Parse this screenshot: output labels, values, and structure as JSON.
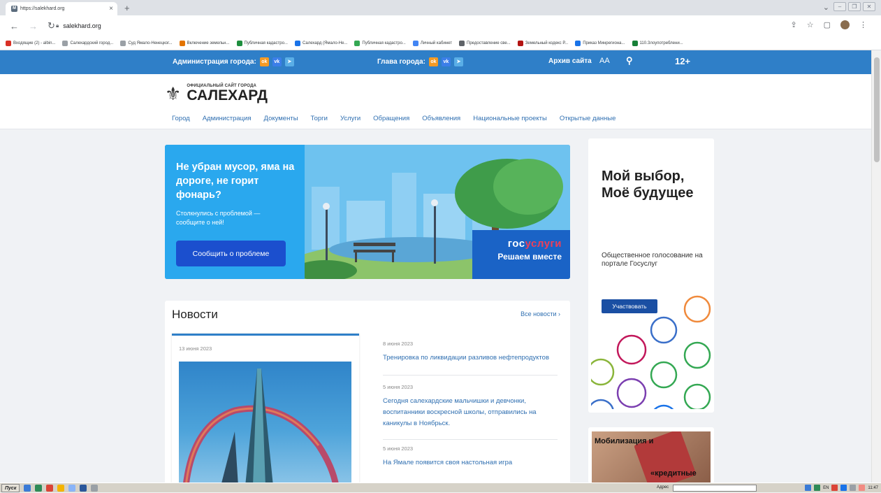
{
  "browser": {
    "tab_title": "https://salekhard.org",
    "tab_close": "×",
    "new_tab": "+",
    "url": "salekhard.org",
    "bookmarks": [
      {
        "label": "Входящие (2) - albin...",
        "color": "#d93025"
      },
      {
        "label": "Салехардский город...",
        "color": "#9aa0a6"
      },
      {
        "label": "Суд Ямало-Ненецког...",
        "color": "#9aa0a6"
      },
      {
        "label": "Включение земельн...",
        "color": "#e37400"
      },
      {
        "label": "Публичная кадастро...",
        "color": "#1e8e3e"
      },
      {
        "label": "Салехард (Ямало-Не...",
        "color": "#1a73e8"
      },
      {
        "label": "Публичная кадастро...",
        "color": "#34a853"
      },
      {
        "label": "Личный кабинет",
        "color": "#4285f4"
      },
      {
        "label": "Предоставление све...",
        "color": "#5f6368"
      },
      {
        "label": "Земельный кодекс Р...",
        "color": "#b31412"
      },
      {
        "label": "Приказ Минрегиона...",
        "color": "#1a73e8"
      },
      {
        "label": "110.Злоупотреблени...",
        "color": "#188038"
      }
    ]
  },
  "site": {
    "topbar": {
      "admin_label": "Администрация города:",
      "head_label": "Глава города:",
      "archive": "Архив сайта",
      "font_size": "AA",
      "age": "12+"
    },
    "logo": {
      "small": "ОФИЦИАЛЬНЫЙ САЙТ ГОРОДА",
      "big": "САЛЕХАРД"
    },
    "menu": [
      "Город",
      "Администрация",
      "Документы",
      "Торги",
      "Услуги",
      "Обращения",
      "Объявления",
      "Национальные проекты",
      "Открытые данные"
    ],
    "banner": {
      "heading": "Не убран мусор, яма на дороге, не горит фонарь?",
      "text": "Столкнулись с проблемой — сообщите о ней!",
      "button": "Сообщить о проблеме",
      "gos_a": "гос",
      "gos_b": "услуги",
      "gos_line2": "Решаем вместе"
    },
    "news": {
      "title": "Новости",
      "all": "Все новости ›",
      "featured_date": "13 июня 2023",
      "items": [
        {
          "date": "8 июня 2023",
          "title": "Тренировка по ликвидации разливов нефтепродуктов"
        },
        {
          "date": "5 июня 2023",
          "title": "Сегодня салехардские мальчишки и девчонки, воспитанники воскресной школы, отправились на каникулы в Ноябрьск."
        },
        {
          "date": "5 июня 2023",
          "title": "На Ямале появится своя настольная игра"
        }
      ]
    },
    "side_vote": {
      "heading": "Мой выбор, Моё будущее",
      "text": "Общественное голосование на портале Госуслуг",
      "button": "Участвовать"
    },
    "side_mob": {
      "line1": "Мобилизация и",
      "line2": "«кредитные"
    }
  },
  "taskbar": {
    "start": "Пуск",
    "address_label": "Адрес",
    "lang": "EN",
    "time": "11:47"
  }
}
